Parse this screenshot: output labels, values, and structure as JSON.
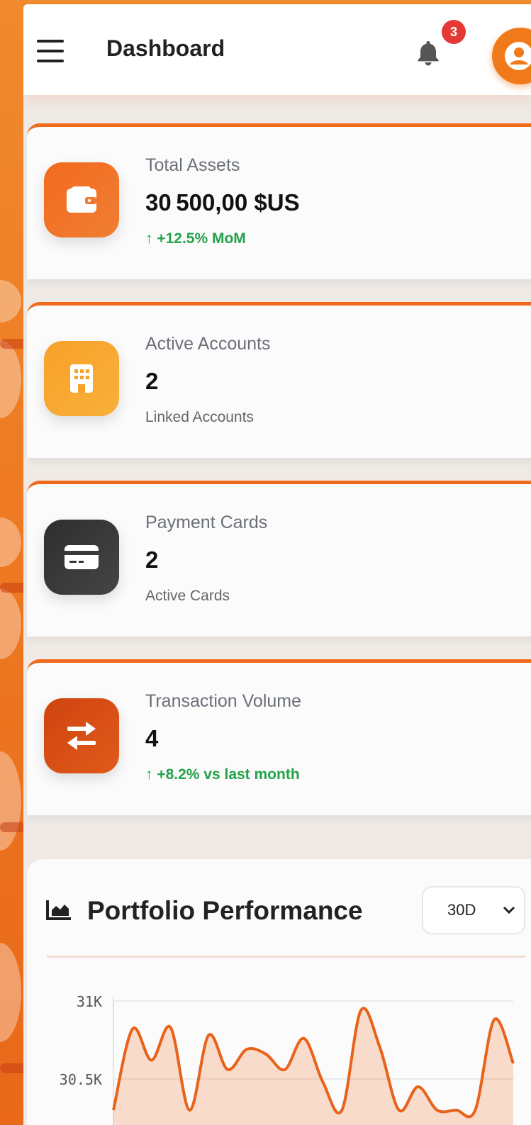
{
  "header": {
    "title": "Dashboard",
    "notification_count": "3",
    "menu_icon": "hamburger-icon",
    "bell_icon": "bell-icon",
    "avatar_icon": "user-avatar-icon"
  },
  "stats": [
    {
      "label": "Total Assets",
      "value": "30 500,00 $US",
      "sub": "↑ +12.5% MoM",
      "sub_trend": "up",
      "icon": "wallet-icon",
      "icon_color": "#ef6a21"
    },
    {
      "label": "Active Accounts",
      "value": "2",
      "sub": "Linked Accounts",
      "sub_trend": "none",
      "icon": "building-icon",
      "icon_color": "#f7a12a"
    },
    {
      "label": "Payment Cards",
      "value": "2",
      "sub": "Active Cards",
      "sub_trend": "none",
      "icon": "credit-card-icon",
      "icon_color": "#3a3a3a"
    },
    {
      "label": "Transaction Volume",
      "value": "4",
      "sub": "↑ +8.2% vs last month",
      "sub_trend": "up",
      "icon": "swap-arrows-icon",
      "icon_color": "#d84e14"
    }
  ],
  "performance": {
    "title": "Portfolio Performance",
    "icon": "area-chart-icon",
    "range_selected": "30D"
  },
  "colors": {
    "accent": "#ef6a1c",
    "positive": "#22a24a",
    "badge": "#e53935"
  },
  "chart_data": {
    "type": "area",
    "yticks": [
      "31K",
      "30.5K"
    ],
    "ylim": [
      30300,
      31000
    ],
    "series": [
      {
        "values": [
          30300,
          30820,
          30620,
          30830,
          30300,
          30780,
          30560,
          30690,
          30660,
          30560,
          30760,
          30480,
          30300,
          30940,
          30700,
          30300,
          30450,
          30300,
          30300,
          30300,
          30880,
          30600
        ]
      }
    ]
  }
}
